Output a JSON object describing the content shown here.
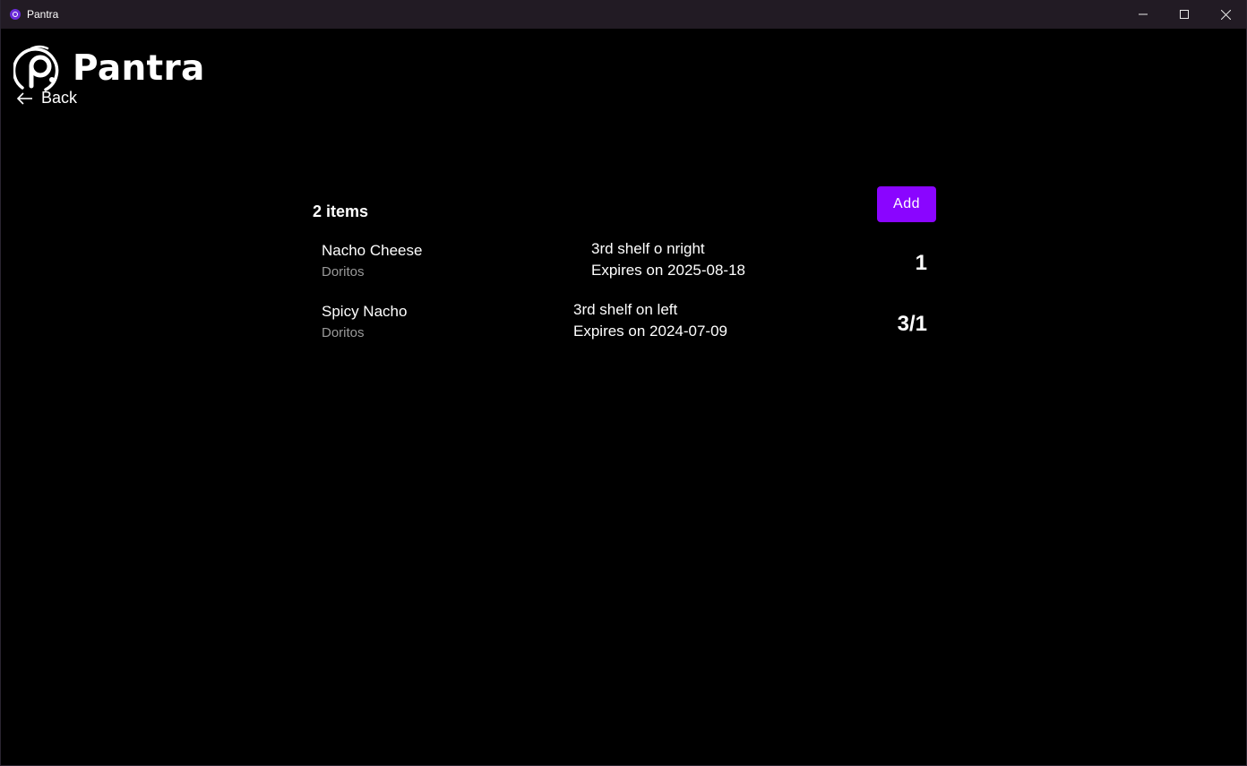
{
  "window": {
    "title": "Pantra",
    "controls": {
      "minimize_icon": "minimize-icon",
      "maximize_icon": "maximize-icon",
      "close_icon": "close-icon"
    }
  },
  "header": {
    "logo_icon": "pantra-logo-icon",
    "app_name": "Pantra",
    "back_label": "Back",
    "back_icon": "arrow-left-icon"
  },
  "list": {
    "count_label": "2 items",
    "add_label": "Add",
    "items": [
      {
        "name": "Nacho Cheese",
        "brand": "Doritos",
        "location": "3rd shelf o nright",
        "expires": "Expires on 2025-08-18",
        "quantity": "1"
      },
      {
        "name": "Spicy Nacho",
        "brand": "Doritos",
        "location": "3rd shelf on left",
        "expires": "Expires on 2024-07-09",
        "quantity": "3/1"
      }
    ]
  },
  "colors": {
    "background": "#000000",
    "titlebar": "#221b24",
    "accent": "#8a05ff",
    "muted_text": "#9a9a9a"
  }
}
